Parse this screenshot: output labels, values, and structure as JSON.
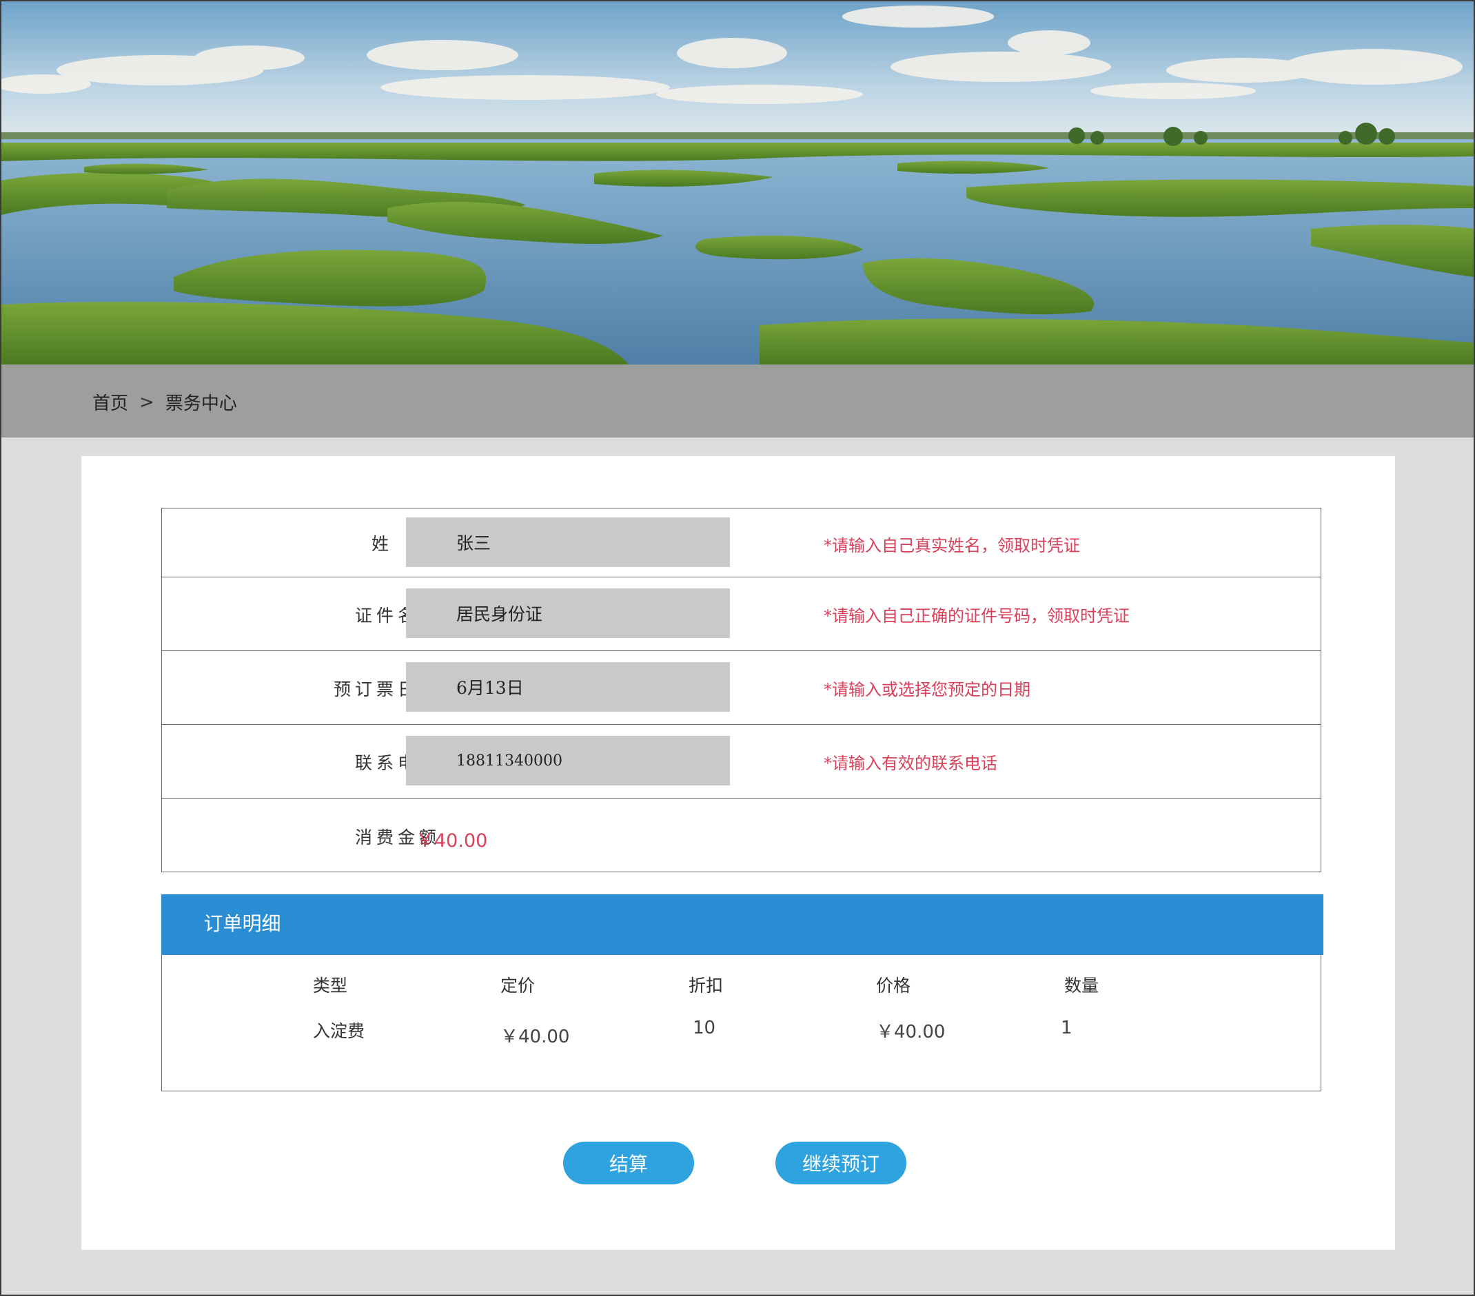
{
  "breadcrumb": {
    "home": "首页",
    "separator": ">",
    "current": "票务中心"
  },
  "form": {
    "name": {
      "label": "姓名",
      "value": "张三",
      "hint": "*请输入自己真实姓名，领取时凭证"
    },
    "id_type": {
      "label": "证件名称",
      "value": "居民身份证",
      "hint": "*请输入自己正确的证件号码，领取时凭证"
    },
    "date": {
      "label": "预订票日期",
      "value": "6月13日",
      "hint": "*请输入或选择您预定的日期"
    },
    "phone": {
      "label": "联系电话",
      "value": "18811340000",
      "hint": "*请输入有效的联系电话"
    },
    "amount": {
      "label": "消费金额",
      "value": "￥40.00"
    }
  },
  "order": {
    "title": "订单明细",
    "columns": [
      "类型",
      "定价",
      "折扣",
      "价格",
      "数量"
    ],
    "rows": [
      [
        "入淀费",
        "￥40.00",
        "10",
        "￥40.00",
        "1"
      ]
    ]
  },
  "buttons": {
    "checkout": "结算",
    "continue": "继续预订"
  },
  "colors": {
    "accent_blue": "#2a8dd3",
    "button_blue": "#2ea3df",
    "hint_red": "#d94059",
    "breadcrumb_bar": "#9d9e9e"
  }
}
